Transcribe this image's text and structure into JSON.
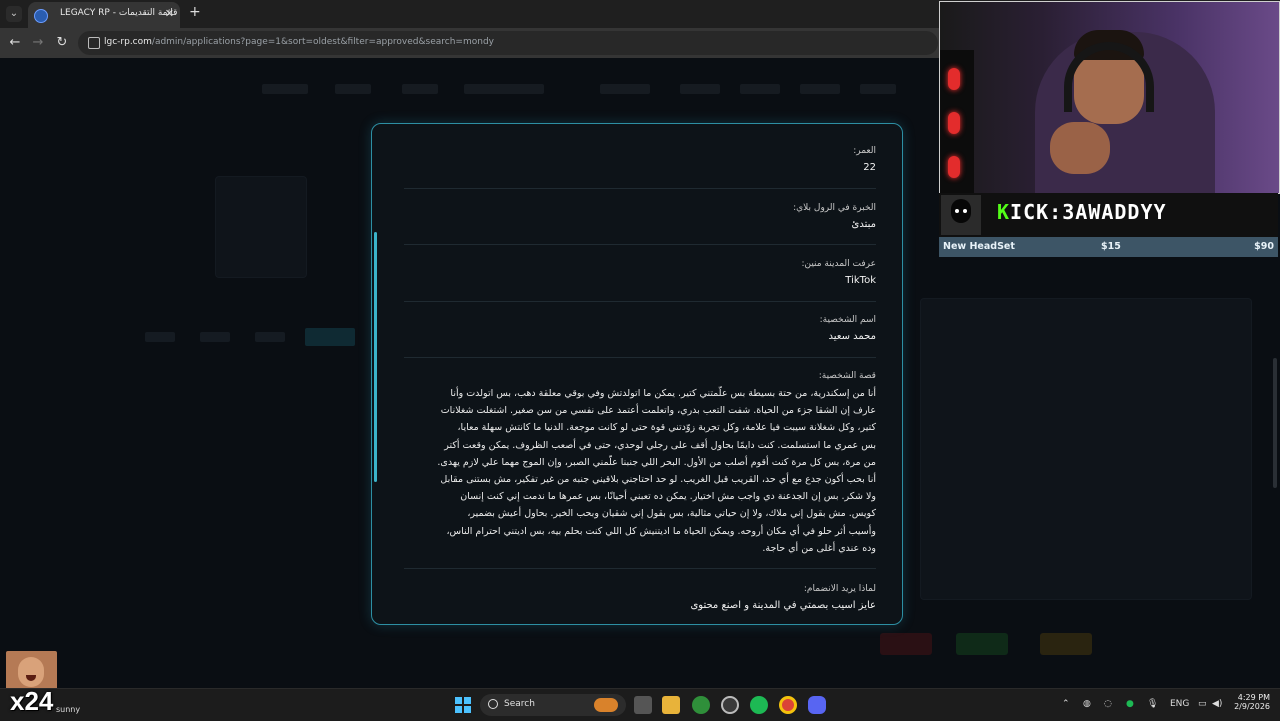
{
  "browser": {
    "tab_title": "LEGACY RP - قائمة التقديمات",
    "url_domain": "lgc-rp.com",
    "url_path": "/admin/applications?page=1&sort=oldest&filter=approved&search=mondy"
  },
  "application": {
    "fields": [
      {
        "label": "العمر:",
        "value": "22"
      },
      {
        "label": "الخبرة في الرول بلاي:",
        "value": "مبتدئ"
      },
      {
        "label": "عرفت المدينة منين:",
        "value": "TikTok"
      },
      {
        "label": "اسم الشخصية:",
        "value": "محمد سعيد"
      }
    ],
    "story_label": "قصة الشخصية:",
    "story_lines": [
      "أنا من إسكندرية، من حتة بسيطة بس علّمتني كتير. يمكن ما اتولدتش وفي بوقي معلقة دهب، بس اتولدت وأنا",
      "عارف إن الشقا جزء من الحياة. شفت التعب بدري، واتعلمت أعتمد على نفسي من سن صغير. اشتغلت شغلانات",
      "كتير، وكل شغلانة سيبت فيا علامة، وكل تجربة زوّدتني قوة حتى لو كانت موجعة. الدنيا ما كانتش سهلة معايا،",
      "بس عمري ما استسلمت. كنت دايمًا بحاول أقف على رجلي لوحدي، حتى في أصعب الظروف. يمكن وقعت أكتر",
      "من مرة، بس كل مرة كنت أقوم أصلب من الأول. البحر اللي جنبنا علّمني الصبر، وإن الموج مهما علي لازم يهدى.",
      "أنا بحب أكون جدع مع أي حد، القريب قبل الغريب. لو حد احتاجني بلاقيني جنبه من غير تفكير، مش بستنى مقابل",
      "ولا شكر. بس إن الجدعنة دي واجب مش اختيار. يمكن ده تعبني أحيانًا، بس عمرها ما ندمت إني كنت إنسان",
      "كويس. مش بقول إني ملاك، ولا إن حياتي مثالية، بس بقول إني شقيان وبحب الخير. بحاول أعيش بضمير،",
      "وأسيب أثر حلو في أي مكان أروحه. ويمكن الحياة ما اديتنيش كل اللي كنت بحلم بيه، بس اديتني احترام الناس،",
      "وده عندي أغلى من أي حاجة."
    ],
    "join_label": "لماذا يريد الانضمام:",
    "join_value": "عايز اسيب بصمتي في المدينة و اصنع محتوى"
  },
  "stream_overlay": {
    "kick_prefix": "K",
    "kick_rest": "ICK:3AWADDYY",
    "goal_name": "New HeadSet",
    "goal_current": "$15",
    "goal_target": "$90",
    "emote_multiplier": "x24"
  },
  "taskbar": {
    "weather_text": "sunny",
    "search_label": "Search",
    "language": "ENG",
    "time": "4:29 PM",
    "date": "2/9/2026"
  }
}
